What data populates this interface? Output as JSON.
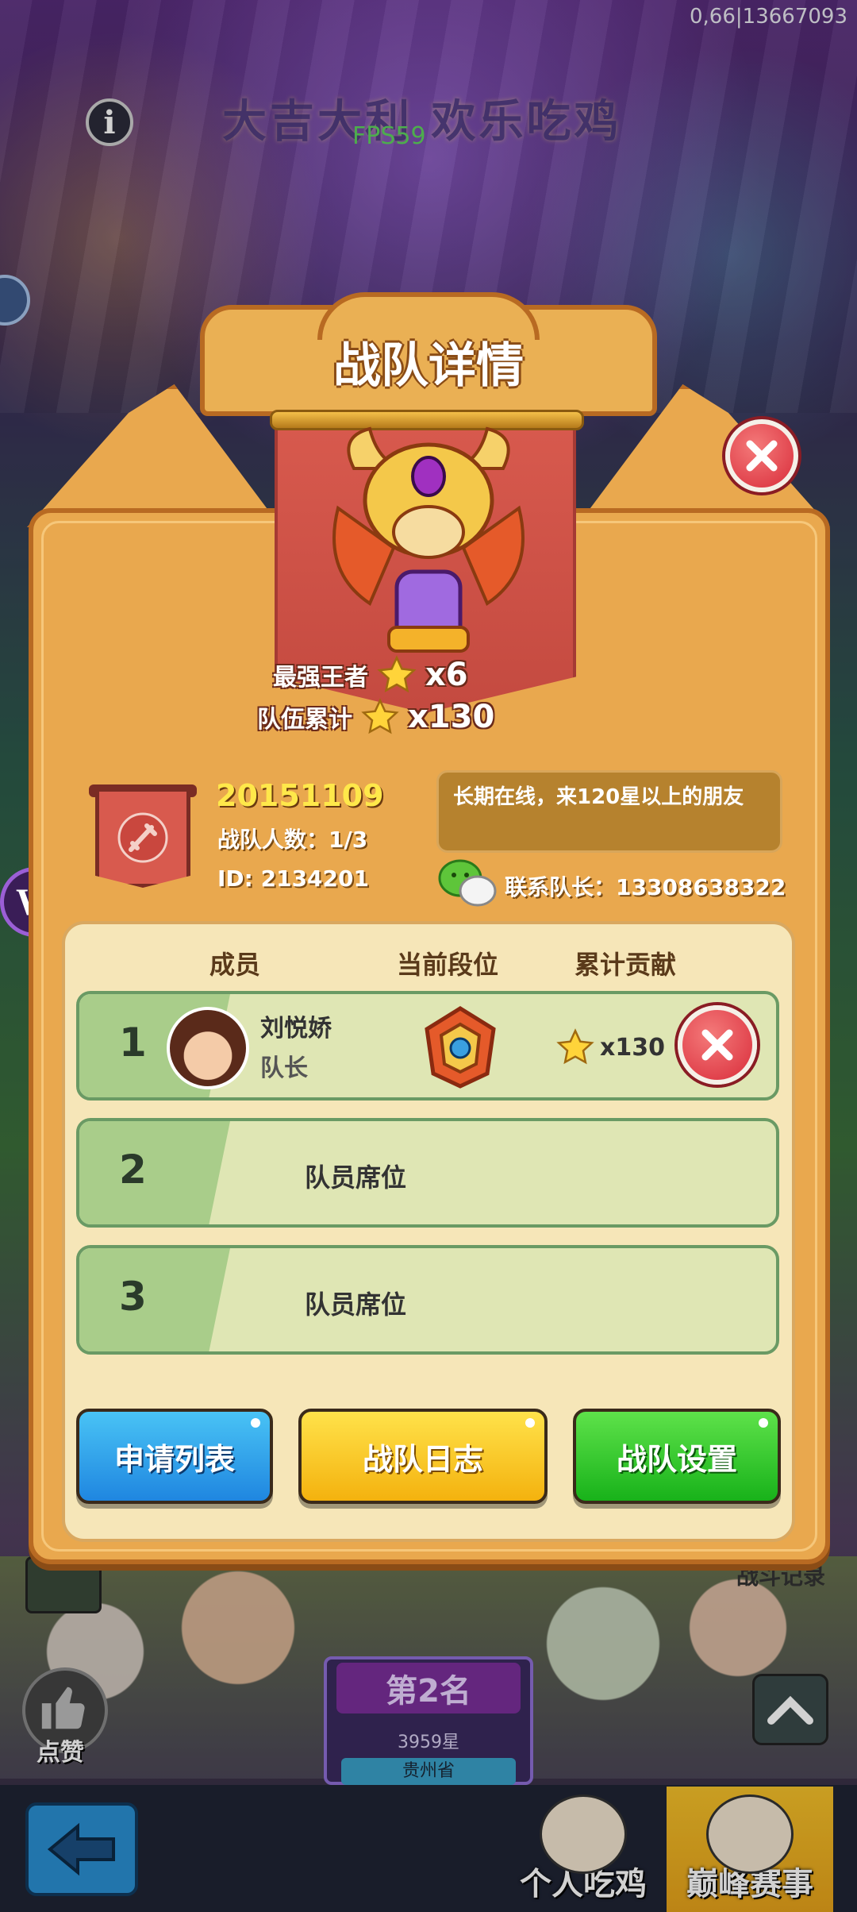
{
  "status": {
    "top_right": "0,66|13667093",
    "fps": "FPS59"
  },
  "header": {
    "game_title": "大吉大利 欢乐吃鸡"
  },
  "dialog": {
    "title": "战队详情",
    "stats": {
      "strongest_label": "最强王者",
      "strongest_value": "x6",
      "total_label": "队伍累计",
      "total_value": "x130"
    },
    "team": {
      "name": "20151109",
      "member_count": "战队人数：1/3",
      "id": "ID: 2134201",
      "notice": "长期在线，来120星以上的朋友",
      "contact": "联系队长：13308638322"
    },
    "columns": {
      "member": "成员",
      "rank": "当前段位",
      "contribution": "累计贡献"
    },
    "members": [
      {
        "num": "1",
        "name": "刘悦娇",
        "role": "队长",
        "contribution": "x130"
      },
      {
        "num": "2",
        "seat": "队员席位"
      },
      {
        "num": "3",
        "seat": "队员席位"
      }
    ],
    "buttons": {
      "apply_list": "申请列表",
      "team_log": "战队日志",
      "team_settings": "战队设置"
    }
  },
  "background": {
    "like_label": "点赞",
    "rank_title": "第2名",
    "rank_stars": "3959星",
    "rank_province": "贵州省",
    "battle_record": "战斗记录"
  },
  "bottom_tabs": {
    "personal": "个人吃鸡",
    "peak": "巅峰赛事"
  },
  "colors": {
    "dialog_bg": "#e9a84e",
    "apply_btn": "#1f86e0",
    "log_btn": "#f4b20e",
    "settings_btn": "#18b21a",
    "close_btn": "#d92c3a"
  }
}
